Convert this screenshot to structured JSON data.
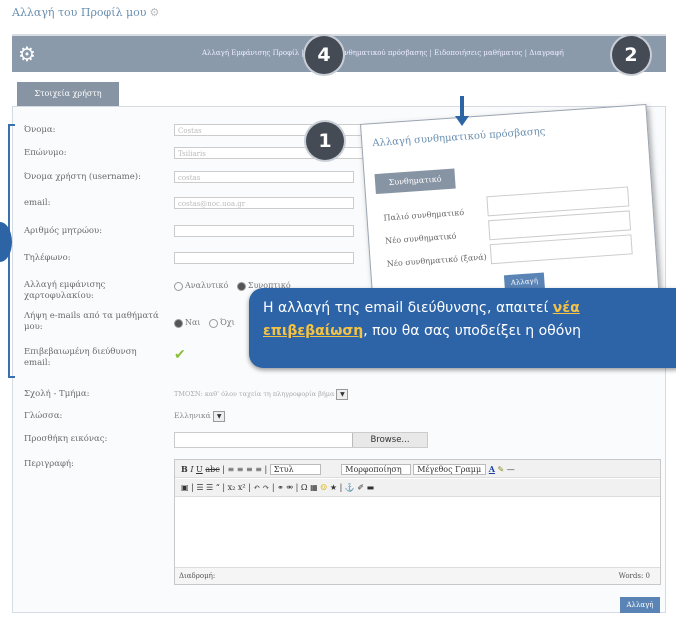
{
  "header": {
    "title": "Αλλαγή του Προφίλ μου",
    "nav_links": "Αλλαγή Εμφάνισης Προφίλ | Αλλαγή συνθηματικού πρόσβασης | Ειδοποιήσεις μαθήματος | Διαγραφή"
  },
  "tab": {
    "label": "Στοιχεία χρήστη"
  },
  "form": {
    "labels": {
      "first_name": "Όνομα:",
      "last_name": "Επώνυμο:",
      "username": "Όνομα χρήστη (username):",
      "email": "email:",
      "am": "Αριθμός μητρώου:",
      "phone": "Τηλέφωνο:",
      "portfolio": "Αλλαγή εμφάνισης χαρτοφυλακίου:",
      "receive_email": "Λήψη e-mails από τα μαθήματά μου:",
      "verified_email": "Επιβεβαιωμένη διεύθυνση email:",
      "faculty": "Σχολή - Τμήμα:",
      "language": "Γλώσσα:",
      "add_image": "Προσθήκη εικόνας:",
      "description": "Περιγραφή:"
    },
    "values": {
      "first_name": "Costas",
      "last_name": "Tsiliaris",
      "username": "costas",
      "email": "costas@noc.uoa.gr",
      "faculty": "ΤΜΟΣΝ: καθ' όλον ταχεία τη πληγροφορία βήμα",
      "language": "Ελληνικά"
    },
    "portfolio_options": [
      "Αναλυτικό",
      "Συνοπτικό"
    ],
    "email_options": [
      "Ναι",
      "Όχι"
    ],
    "browse_label": "Browse...",
    "editor": {
      "path_label": "Διαδρομή:",
      "words_label": "Words: 0",
      "style_select": "Στυλ",
      "format_select": "Μορφοποίηση",
      "size_select": "Μέγεθος Γραμμ"
    },
    "save_label": "Αλλαγή"
  },
  "popup": {
    "title": "Αλλαγή συνθηματικού πρόσβασης",
    "box_label": "Συνθηματικό",
    "labels": [
      "Παλιό συνθηματικό",
      "Νέο συνθηματικό",
      "Νέο συνθηματικό (ξανά)"
    ],
    "button": "Αλλαγή"
  },
  "callout": {
    "line1_pre": "Η αλλαγή της email διεύθυνσης, απαιτεί ",
    "line1_hl": "νέα",
    "line2_hl": "επιβεβαίωση",
    "line2_post": ", που θα σας υποδείξει η οθόνη"
  },
  "badges": {
    "b1": "1",
    "b2": "2",
    "b4": "4"
  },
  "icons": {
    "gear": "gear-icon",
    "check": "check-icon"
  }
}
